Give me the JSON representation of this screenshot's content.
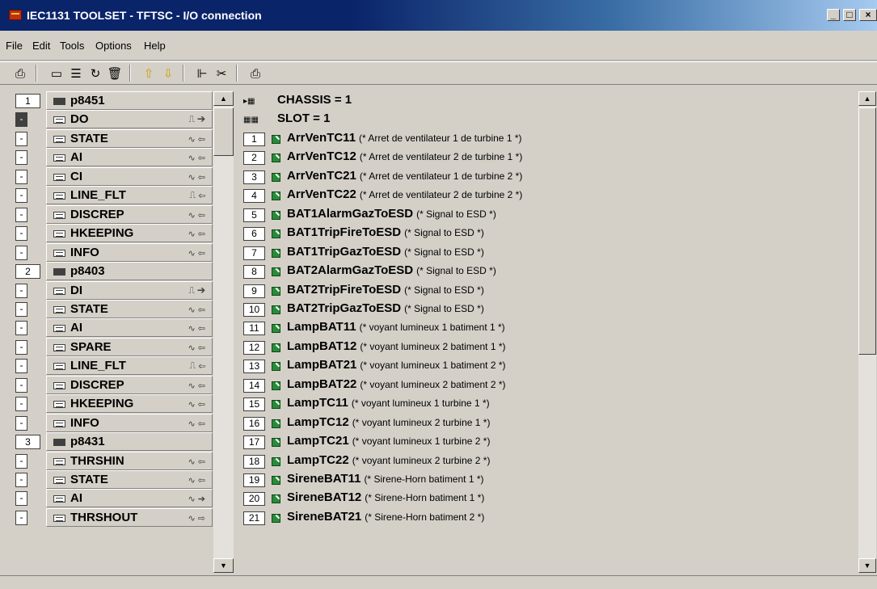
{
  "window": {
    "title": "IEC1131 TOOLSET - TFTSC - I/O connection",
    "buttons": [
      "_",
      "□",
      "×"
    ]
  },
  "menu": [
    "File",
    "Edit",
    "Tools",
    "Options",
    "Help"
  ],
  "toolbar": {
    "icons": [
      "open-icon",
      "card-icon",
      "layers-icon",
      "connect-icon",
      "delete-icon",
      "arrow-up-icon",
      "arrow-down-icon",
      "tree-icon",
      "cut-icon",
      "print-icon"
    ],
    "glyphs": [
      "⎙",
      "▭",
      "☰",
      "↻",
      "🗑",
      "⇧",
      "⇩",
      "⊩",
      "✂",
      "⎙"
    ]
  },
  "left_tree": [
    {
      "kind": "module",
      "index": "1",
      "label": "p8451",
      "sig": ""
    },
    {
      "kind": "channel",
      "mark": "-",
      "label": "DO",
      "sig": "⎍ ➔",
      "selected": true
    },
    {
      "kind": "channel",
      "mark": "-",
      "label": "STATE",
      "sig": "∿ ⇦"
    },
    {
      "kind": "channel",
      "mark": "-",
      "label": "AI",
      "sig": "∿ ⇦"
    },
    {
      "kind": "channel",
      "mark": "-",
      "label": "CI",
      "sig": "∿ ⇦"
    },
    {
      "kind": "channel",
      "mark": "-",
      "label": "LINE_FLT",
      "sig": "⎍ ⇦"
    },
    {
      "kind": "channel",
      "mark": "-",
      "label": "DISCREP",
      "sig": "∿ ⇦"
    },
    {
      "kind": "channel",
      "mark": "-",
      "label": "HKEEPING",
      "sig": "∿ ⇦"
    },
    {
      "kind": "channel",
      "mark": "-",
      "label": "INFO",
      "sig": "∿ ⇦"
    },
    {
      "kind": "module",
      "index": "2",
      "label": "p8403",
      "sig": ""
    },
    {
      "kind": "channel",
      "mark": "-",
      "label": "DI",
      "sig": "⎍ ➔"
    },
    {
      "kind": "channel",
      "mark": "-",
      "label": "STATE",
      "sig": "∿ ⇦"
    },
    {
      "kind": "channel",
      "mark": "-",
      "label": "AI",
      "sig": "∿ ⇦"
    },
    {
      "kind": "channel",
      "mark": "-",
      "label": "SPARE",
      "sig": "∿ ⇦"
    },
    {
      "kind": "channel",
      "mark": "-",
      "label": "LINE_FLT",
      "sig": "⎍ ⇦"
    },
    {
      "kind": "channel",
      "mark": "-",
      "label": "DISCREP",
      "sig": "∿ ⇦"
    },
    {
      "kind": "channel",
      "mark": "-",
      "label": "HKEEPING",
      "sig": "∿ ⇦"
    },
    {
      "kind": "channel",
      "mark": "-",
      "label": "INFO",
      "sig": "∿ ⇦"
    },
    {
      "kind": "module",
      "index": "3",
      "label": "p8431",
      "sig": ""
    },
    {
      "kind": "channel",
      "mark": "-",
      "label": "THRSHIN",
      "sig": "∿ ⇦"
    },
    {
      "kind": "channel",
      "mark": "-",
      "label": "STATE",
      "sig": "∿ ⇦"
    },
    {
      "kind": "channel",
      "mark": "-",
      "label": "AI",
      "sig": "∿ ➔"
    },
    {
      "kind": "channel",
      "mark": "-",
      "label": "THRSHOUT",
      "sig": "∿ ⇨"
    }
  ],
  "right_list": {
    "chassis": "CHASSIS = 1",
    "slot": "SLOT = 1",
    "items": [
      {
        "n": "1",
        "name": "ArrVenTC11",
        "comment": "(* Arret de ventilateur 1 de turbine 1 *)"
      },
      {
        "n": "2",
        "name": "ArrVenTC12",
        "comment": "(* Arret de ventilateur 2 de turbine 1 *)"
      },
      {
        "n": "3",
        "name": "ArrVenTC21",
        "comment": "(* Arret de ventilateur 1 de turbine 2 *)"
      },
      {
        "n": "4",
        "name": "ArrVenTC22",
        "comment": "(* Arret de ventilateur 2 de turbine 2 *)"
      },
      {
        "n": "5",
        "name": "BAT1AlarmGazToESD",
        "comment": "(* Signal to ESD *)"
      },
      {
        "n": "6",
        "name": "BAT1TripFireToESD",
        "comment": "(* Signal to ESD *)"
      },
      {
        "n": "7",
        "name": "BAT1TripGazToESD",
        "comment": "(* Signal to ESD *)"
      },
      {
        "n": "8",
        "name": "BAT2AlarmGazToESD",
        "comment": "(* Signal to ESD *)"
      },
      {
        "n": "9",
        "name": "BAT2TripFireToESD",
        "comment": "(* Signal to ESD *)"
      },
      {
        "n": "10",
        "name": "BAT2TripGazToESD",
        "comment": "(* Signal to ESD *)"
      },
      {
        "n": "11",
        "name": "LampBAT11",
        "comment": "(* voyant lumineux 1 batiment 1 *)"
      },
      {
        "n": "12",
        "name": "LampBAT12",
        "comment": "(* voyant lumineux 2 batiment 1 *)"
      },
      {
        "n": "13",
        "name": "LampBAT21",
        "comment": "(* voyant lumineux 1 batiment 2 *)"
      },
      {
        "n": "14",
        "name": "LampBAT22",
        "comment": "(* voyant lumineux 2 batiment 2 *)"
      },
      {
        "n": "15",
        "name": "LampTC11",
        "comment": "(* voyant lumineux 1 turbine 1 *)"
      },
      {
        "n": "16",
        "name": "LampTC12",
        "comment": "(* voyant lumineux 2 turbine 1 *)"
      },
      {
        "n": "17",
        "name": "LampTC21",
        "comment": "(* voyant lumineux 1 turbine 2 *)"
      },
      {
        "n": "18",
        "name": "LampTC22",
        "comment": "(* voyant lumineux 2 turbine 2 *)"
      },
      {
        "n": "19",
        "name": "SireneBAT11",
        "comment": "(* Sirene-Horn batiment 1 *)"
      },
      {
        "n": "20",
        "name": "SireneBAT12",
        "comment": "(* Sirene-Horn batiment 1 *)"
      },
      {
        "n": "21",
        "name": "SireneBAT21",
        "comment": "(* Sirene-Horn batiment 2 *)"
      }
    ]
  },
  "scroll": {
    "up": "▲",
    "down": "▼"
  }
}
